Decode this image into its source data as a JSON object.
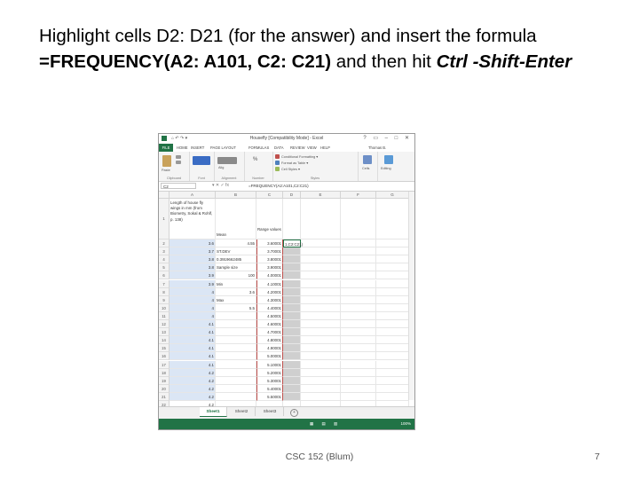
{
  "slide": {
    "title_part1": "Highlight cells D2: D21 (for the answer) and insert the formula ",
    "title_formula": "=FREQUENCY(A2: A101, C2: C21)",
    "title_part2": " and then hit ",
    "title_keys": "Ctrl -Shift-Enter",
    "footer": "CSC 152 (Blum)",
    "page_number": "7"
  },
  "excel": {
    "title": "Housefly [Compatibility Mode] - Excel",
    "window_controls": "? ▭ – □ ✕",
    "quick_access": "⌂ ↶ ↷ ▾",
    "ribbon_tabs": [
      "FILE",
      "HOME",
      "INSERT",
      "PAGE LAYOUT",
      "FORMULAS",
      "DATA",
      "REVIEW",
      "VIEW",
      "HELP",
      "Thomas B."
    ],
    "ribbon_groups": {
      "clipboard": "Clipboard",
      "paste": "Paste",
      "font": "Font",
      "alignment": "Alignment",
      "alignment_short": "Alig",
      "number": "Number",
      "number_pct": "%",
      "conditional_formatting": "Conditional Formatting ▾",
      "format_as_table": "Format as Table ▾",
      "cell_styles": "Cell Styles ▾",
      "styles": "Styles",
      "cells": "Cells",
      "editing": "Editing"
    },
    "name_box": "C2",
    "fx_icons": "▾ ✕ ✓ fx",
    "formula_bar": "=FREQUENCY(A2:A101,C2:C21)",
    "columns": [
      "A",
      "B",
      "C",
      "D",
      "E",
      "F",
      "G"
    ],
    "header_text": {
      "A1": "Length of house fly wings in mm (from Biometry, Sokal & Rohlf, p. 138)",
      "B1": "Mean",
      "C1": "Range values"
    },
    "d2_text": "1,C2:C21)",
    "rows": [
      {
        "n": "2",
        "a": "3.6",
        "b": "",
        "bv": "4.55",
        "c": "3.60001"
      },
      {
        "n": "3",
        "a": "3.7",
        "b": "ST.DEV",
        "bv": "",
        "c": "3.70001"
      },
      {
        "n": "4",
        "a": "3.8",
        "b": "0.3919662485",
        "bv": "",
        "c": "3.80001"
      },
      {
        "n": "5",
        "a": "3.8",
        "b": "Sample size",
        "bv": "",
        "c": "3.90001"
      },
      {
        "n": "6",
        "a": "3.9",
        "b": "",
        "bv": "100",
        "c": "4.00001"
      },
      {
        "n": "7",
        "a": "3.9",
        "b": "Min",
        "bv": "",
        "c": "4.10001"
      },
      {
        "n": "8",
        "a": "4",
        "b": "",
        "bv": "3.6",
        "c": "4.20001"
      },
      {
        "n": "9",
        "a": "4",
        "b": "Max",
        "bv": "",
        "c": "4.30001"
      },
      {
        "n": "10",
        "a": "4",
        "b": "",
        "bv": "5.5",
        "c": "4.40001"
      },
      {
        "n": "11",
        "a": "4",
        "b": "",
        "bv": "",
        "c": "4.50001"
      },
      {
        "n": "12",
        "a": "4.1",
        "b": "",
        "bv": "",
        "c": "4.60001"
      },
      {
        "n": "13",
        "a": "4.1",
        "b": "",
        "bv": "",
        "c": "4.70001"
      },
      {
        "n": "14",
        "a": "4.1",
        "b": "",
        "bv": "",
        "c": "4.80001"
      },
      {
        "n": "15",
        "a": "4.1",
        "b": "",
        "bv": "",
        "c": "4.90001"
      },
      {
        "n": "16",
        "a": "4.1",
        "b": "",
        "bv": "",
        "c": "5.00001"
      },
      {
        "n": "17",
        "a": "4.1",
        "b": "",
        "bv": "",
        "c": "5.10001"
      },
      {
        "n": "18",
        "a": "4.2",
        "b": "",
        "bv": "",
        "c": "5.20001"
      },
      {
        "n": "19",
        "a": "4.2",
        "b": "",
        "bv": "",
        "c": "5.30001"
      },
      {
        "n": "20",
        "a": "4.2",
        "b": "",
        "bv": "",
        "c": "5.40001"
      },
      {
        "n": "21",
        "a": "4.2",
        "b": "",
        "bv": "",
        "c": "5.50001"
      },
      {
        "n": "22",
        "a": "4.2",
        "b": "",
        "bv": "",
        "c": ""
      }
    ],
    "sheet_tabs": [
      "Sheet1",
      "Sheet2",
      "Sheet3"
    ],
    "add_sheet": "+",
    "status_icons": "▦ ▤ ▥",
    "zoom": "100%",
    "colors": {
      "excel_green": "#217346",
      "selected_range": "#dbe6f5",
      "array_range": "#cfcfcf"
    }
  }
}
